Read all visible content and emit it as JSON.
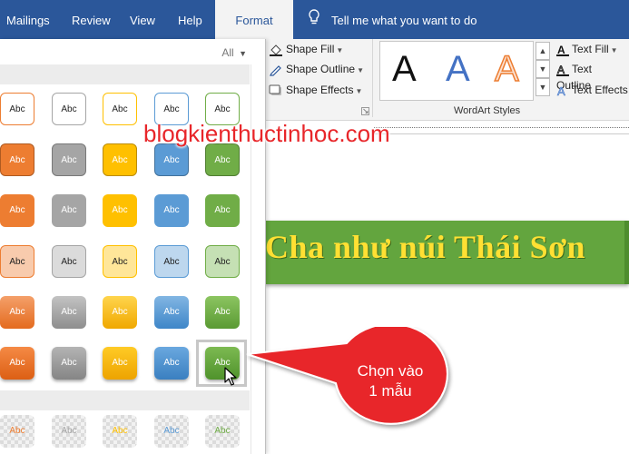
{
  "tabs": [
    {
      "label": "Mailings"
    },
    {
      "label": "Review"
    },
    {
      "label": "View"
    },
    {
      "label": "Help"
    },
    {
      "label": "Format",
      "active": true
    }
  ],
  "tell_me": {
    "placeholder": "Tell me what you want to do"
  },
  "shape_styles": {
    "fill_label": "Shape Fill",
    "outline_label": "Shape Outline",
    "effects_label": "Shape Effects"
  },
  "wordart": {
    "group_label": "WordArt Styles",
    "samples": [
      "A",
      "A",
      "A"
    ],
    "text_fill_label": "Text Fill",
    "text_outline_label": "Text Outline",
    "text_effects_label": "Text Effects"
  },
  "gallery": {
    "filter_label": "All",
    "swatch_label": "Abc",
    "colors": [
      "#ed7d31",
      "#a5a5a5",
      "#ffc000",
      "#5b9bd5",
      "#70ad47"
    ]
  },
  "watermark": "blogkienthuctinhoc.com",
  "document": {
    "wordart_text": "Cha như núi Thái Sơn"
  },
  "callout": {
    "line1": "Chọn vào",
    "line2": "1 mẫu"
  },
  "colors": {
    "ribbon_blue": "#2b579a",
    "callout_red": "#e8262a",
    "banner_green": "#63a53e",
    "wordart_yellow": "#ffe033"
  }
}
